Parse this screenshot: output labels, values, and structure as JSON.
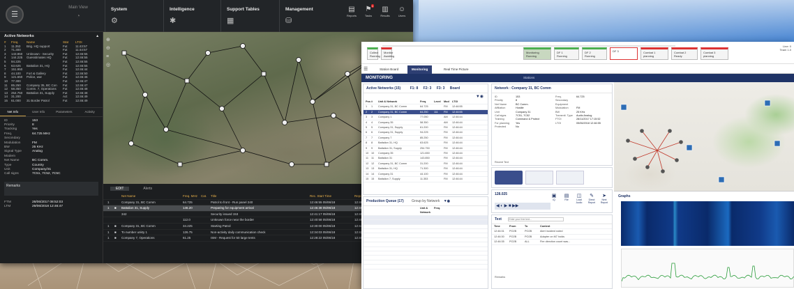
{
  "dark": {
    "app": {
      "name": "Main View"
    },
    "modules": [
      {
        "label": "System"
      },
      {
        "label": "Intelligence"
      },
      {
        "label": "Support Tables"
      },
      {
        "label": "Management"
      }
    ],
    "toolbar": [
      {
        "label": "Reports",
        "icon": "document-icon"
      },
      {
        "label": "Tasks",
        "icon": "flag-icon",
        "badge": "1"
      },
      {
        "label": "Results",
        "icon": "chart-icon"
      },
      {
        "label": "Users",
        "icon": "users-icon"
      }
    ],
    "active_networks": {
      "title": "Active Networks",
      "headers": [
        "#",
        "Freq.",
        "Name",
        "Stat",
        "LTOI"
      ],
      "rows": [
        [
          "1",
          "11.353",
          "Brig. HQ support",
          "Fut",
          "11:43:57"
        ],
        [
          "2",
          "71.300",
          "",
          "Fut",
          "11:44:57"
        ],
        [
          "3",
          "143.850",
          "Unknown - Security",
          "Fut",
          "12:46:55"
        ],
        [
          "4",
          "144.225",
          "Guesstimates HQ",
          "Fut",
          "12:46:55"
        ],
        [
          "5",
          "94.225",
          "",
          "Fut",
          "12:46:55"
        ],
        [
          "6",
          "63.625",
          "Battalion 31, HQ",
          "Fut",
          "12:46:55"
        ],
        [
          "7",
          "151.950",
          "",
          "Fut",
          "12:46:44"
        ],
        [
          "8",
          "44.100",
          "Fort & Gallery",
          "Fut",
          "12:46:50"
        ],
        [
          "9",
          "121.650",
          "Police, war",
          "Fut",
          "12:46:46"
        ],
        [
          "10",
          "77.300",
          "",
          "Fut",
          "12:46:47"
        ],
        [
          "11",
          "85.250",
          "Company 35, BC Con",
          "Fut",
          "12:46:47"
        ],
        [
          "12",
          "58.350",
          "Comm. 7, Operations",
          "Fut",
          "12:46:48"
        ],
        [
          "13",
          "254.750",
          "Battalion 31, Supply",
          "Fut",
          "12:46:48"
        ],
        [
          "14",
          "31.200",
          "",
          "Act",
          "12:46:49"
        ],
        [
          "15",
          "61.000",
          "31 Border Patrol",
          "Fut",
          "12:46:49"
        ]
      ]
    },
    "tabs": [
      "Net Info",
      "User Info",
      "Parameters",
      "Activity"
    ],
    "props": [
      [
        "ID",
        "153"
      ],
      [
        "Priority",
        "8"
      ],
      [
        "Tracking",
        "Yes"
      ],
      [
        "Freq.",
        "64.725 MHz"
      ],
      [
        "Secondary",
        ""
      ],
      [
        "Modulation",
        "FM"
      ],
      [
        "BW",
        "25 KHz"
      ],
      [
        "Signal Type",
        "Analog"
      ],
      [
        "Modem",
        ""
      ],
      [
        "Net Name",
        "BC Comm."
      ],
      [
        "Type",
        "Country"
      ],
      [
        "Unit",
        "Company/31"
      ],
      [
        "Call signs",
        "7C51, 7C52, 7C5C"
      ]
    ],
    "remarks_label": "Remarks",
    "footer": [
      [
        "FTM",
        "28/06/2017 08:52:03"
      ],
      [
        "LTM",
        "29/06/2018 12:46:47"
      ]
    ],
    "bottom_tabs": [
      "EDIT",
      "Alerts"
    ],
    "activity": {
      "headers": [
        "",
        "",
        "Net Name",
        "Freq. MHz",
        "Cat.",
        "Title",
        "Rec. Start Time",
        "Reported Time"
      ],
      "rows": [
        [
          "1",
          "",
          "Company 31, BC Comm",
          "64.725",
          "",
          "Patrol to front - Run panel 240",
          "12:46:55 05/06/18",
          "12:46:56 05/06/18"
        ],
        [
          "1",
          "■",
          "Battalion 31, Supply",
          "146.20",
          "",
          "Preparing for equipment arrival",
          "12:46:38 05/06/18",
          "12:46:51 05/06/18"
        ],
        [
          "",
          "",
          "342",
          "",
          "",
          "Security issued 153",
          "12:41:17 05/06/18",
          "12:45:01 05/06/18"
        ],
        [
          "",
          "",
          "",
          "112.0",
          "",
          "Unknown force near the border",
          "12:40:58 05/06/18",
          "12:45:01 05/06/18"
        ],
        [
          "1",
          "■",
          "Company 31, BC Comm",
          "34.225",
          "",
          "Starting Patrol",
          "12:30:00 05/06/18",
          "12:44:03 05/06/18"
        ],
        [
          "1",
          "■",
          "To number unkty 1",
          "126.75",
          "",
          "Non-activity daily communication check",
          "12:34:03 05/06/18",
          "12:42:51 05/06/18"
        ],
        [
          "1",
          "■",
          "Company 7, Operations",
          "61.25",
          "",
          "ISM - Request for 50 large tents",
          "12:28:22 05/06/18",
          "12:40:12 05/06/18"
        ]
      ]
    }
  },
  "light": {
    "workflow": [
      {
        "label": "Collect",
        "sub": "Running",
        "state": "green"
      },
      {
        "label": "Monitor",
        "sub": "Awaiting",
        "state": "red"
      },
      {
        "label": "Monitoring",
        "sub": "Running",
        "state": "green-act"
      },
      {
        "label": "DF 1",
        "sub": "Running",
        "state": "green"
      },
      {
        "label": "DF 2",
        "sub": "Running",
        "state": "green"
      },
      {
        "label": "DF 3",
        "sub": "",
        "state": "redbox"
      },
      {
        "label": "Combat 1",
        "sub": "planning",
        "state": "red"
      },
      {
        "label": "Combat 2",
        "sub": "Ready",
        "state": "red"
      },
      {
        "label": "Combat 3",
        "sub": "planning",
        "state": "red"
      }
    ],
    "workflow_right": [
      "Line: 0",
      "Team 1.0"
    ],
    "nav": [
      "Station Board",
      "Monitoring",
      "Real Time Picture"
    ],
    "header": {
      "title": "MONITORING",
      "center": "Stations"
    },
    "active_networks": {
      "title": "Active Networks (15)",
      "counts": [
        "F1: 8",
        "F2: 3",
        "F3: 3",
        "Board"
      ],
      "headers": [
        "Pos",
        "#",
        "Unit & Network",
        "Freq.",
        "Level",
        "Mod",
        "LTOI"
      ],
      "rows": [
        [
          "1",
          "1",
          "Company 31, BC Comm",
          "64.725",
          "",
          "FM",
          "12:46:55"
        ],
        [
          "2",
          "2",
          "Company 31, BC Comm",
          "64.250",
          "111",
          "FM",
          "12:46:55"
        ],
        [
          "3",
          "3",
          "Company 1",
          "77.050",
          "",
          "AM",
          "12:46:44"
        ],
        [
          "4",
          "4",
          "Company 35",
          "58.350",
          "",
          "AM",
          "12:46:44"
        ],
        [
          "5",
          "5",
          "Company 31, Supply",
          "61.200",
          "",
          "FM",
          "12:46:44"
        ],
        [
          "6",
          "6",
          "Company 31, Supply",
          "94.225",
          "",
          "FM",
          "12:46:44"
        ],
        [
          "7",
          "7",
          "Company 7",
          "85.250",
          "",
          "FM",
          "12:46:44"
        ],
        [
          "8",
          "8",
          "Battalion 31, HQ",
          "63.625",
          "",
          "FM",
          "12:46:44"
        ],
        [
          "9",
          "9",
          "Battalion 31, Supply",
          "254.750",
          "",
          "FM",
          "12:46:44"
        ],
        [
          "10",
          "10",
          "Company 35",
          "121.650",
          "",
          "FM",
          "12:46:44"
        ],
        [
          "11",
          "11",
          "Battalion 31",
          "143.850",
          "",
          "FM",
          "12:46:44"
        ],
        [
          "12",
          "12",
          "Company 31, BC Comm",
          "31.200",
          "",
          "FM",
          "12:46:44"
        ],
        [
          "13",
          "13",
          "Battalion 31, HQ",
          "71.300",
          "",
          "FM",
          "12:46:44"
        ],
        [
          "14",
          "14",
          "Company 31",
          "44.100",
          "",
          "FM",
          "12:46:44"
        ],
        [
          "15",
          "15",
          "Battalion 7, Supply",
          "11.353",
          "",
          "FM",
          "12:46:44"
        ]
      ]
    },
    "network": {
      "title": "Network : Company 31, BC Comm",
      "kv": [
        [
          "ID",
          "153"
        ],
        [
          "Priority",
          "8"
        ],
        [
          "Net Name",
          "BC Comm."
        ],
        [
          "Affiliation",
          "Hostile"
        ],
        [
          "Unit",
          "Company 31"
        ],
        [
          "Call signs",
          "7C51, 7C52"
        ],
        [
          "Training",
          "Command & Protect"
        ],
        [
          "For planning",
          "Yes"
        ],
        [
          "Protected",
          "No"
        ]
      ],
      "kv2": [
        [
          "Freq.",
          "64.725"
        ],
        [
          "Secondary",
          ""
        ],
        [
          "Equipment",
          ""
        ],
        [
          "Modulation",
          "FM"
        ],
        [
          "BW",
          "25 KHz"
        ],
        [
          "Transmit. Type",
          "Audio Analog"
        ],
        [
          "FTOI",
          "28/11/2017 17:15:52"
        ],
        [
          "LTOI",
          "05/06/2018 12:46:55"
        ]
      ],
      "recent_label": "Recent Text"
    },
    "queue": {
      "title": "Production Queue (17)",
      "group_label": "Group by Network",
      "headers": [
        "",
        "",
        "",
        "Unit & Network",
        "Freq."
      ]
    },
    "player": {
      "time": "128.025",
      "tabs": [
        "IQ",
        "File",
        "Load Audio",
        "Direct Report",
        "Next Report"
      ]
    },
    "text_panel": {
      "title": "Text",
      "placeholder": "Enter your free text...",
      "headers": [
        "Time",
        "From",
        "To",
        "Content"
      ],
      "rows": [
        [
          "12:46:31",
          "PO2B",
          "PO2B",
          "Alert incident noted"
        ],
        [
          "12:46:30",
          "PO2B",
          "PO2B",
          "Adapter on M7 holds"
        ],
        [
          "12:46:35",
          "PO2B",
          "ALL",
          "Fire direction count was..."
        ]
      ],
      "remarks_label": "Remarks"
    },
    "graphs": {
      "title": "Graphs"
    }
  }
}
